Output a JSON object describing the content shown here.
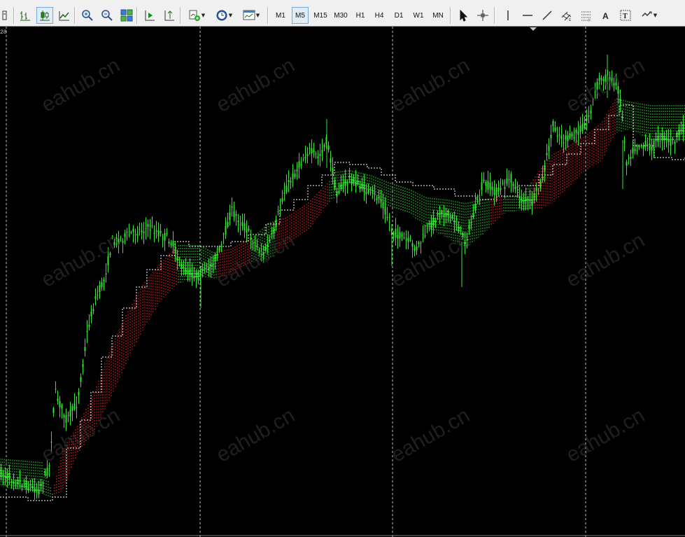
{
  "toolbar": {
    "timeframes": [
      "M1",
      "M5",
      "M15",
      "M30",
      "H1",
      "H4",
      "D1",
      "W1",
      "MN"
    ],
    "active_timeframe": "M5",
    "tools": [
      {
        "name": "chart-window-icon"
      },
      {
        "name": "bar-chart-icon"
      },
      {
        "name": "candlestick-chart-icon"
      },
      {
        "name": "line-chart-icon"
      },
      {
        "name": "zoom-in-icon"
      },
      {
        "name": "zoom-out-icon"
      },
      {
        "name": "tile-windows-icon"
      },
      {
        "name": "auto-scroll-icon"
      },
      {
        "name": "chart-shift-icon"
      },
      {
        "name": "indicators-icon"
      },
      {
        "name": "periods-clock-icon"
      },
      {
        "name": "templates-icon"
      },
      {
        "name": "cursor-icon"
      },
      {
        "name": "crosshair-icon"
      },
      {
        "name": "vertical-line-icon"
      },
      {
        "name": "horizontal-line-icon"
      },
      {
        "name": "trendline-icon"
      },
      {
        "name": "equidistant-channel-icon"
      },
      {
        "name": "fibonacci-retracement-icon"
      },
      {
        "name": "text-icon"
      },
      {
        "name": "text-label-icon"
      },
      {
        "name": "arrows-icon"
      }
    ]
  },
  "chart": {
    "corner_label": "28",
    "colors": {
      "background": "#000000",
      "candles": "#32e632",
      "cloud_up": "#2fbf2f",
      "cloud_down": "#e02020",
      "dashed_line": "#ffffff",
      "grid": "#c0c0c0",
      "watermark": "#3a3a3a"
    },
    "watermark_text": "eahub.cn"
  }
}
